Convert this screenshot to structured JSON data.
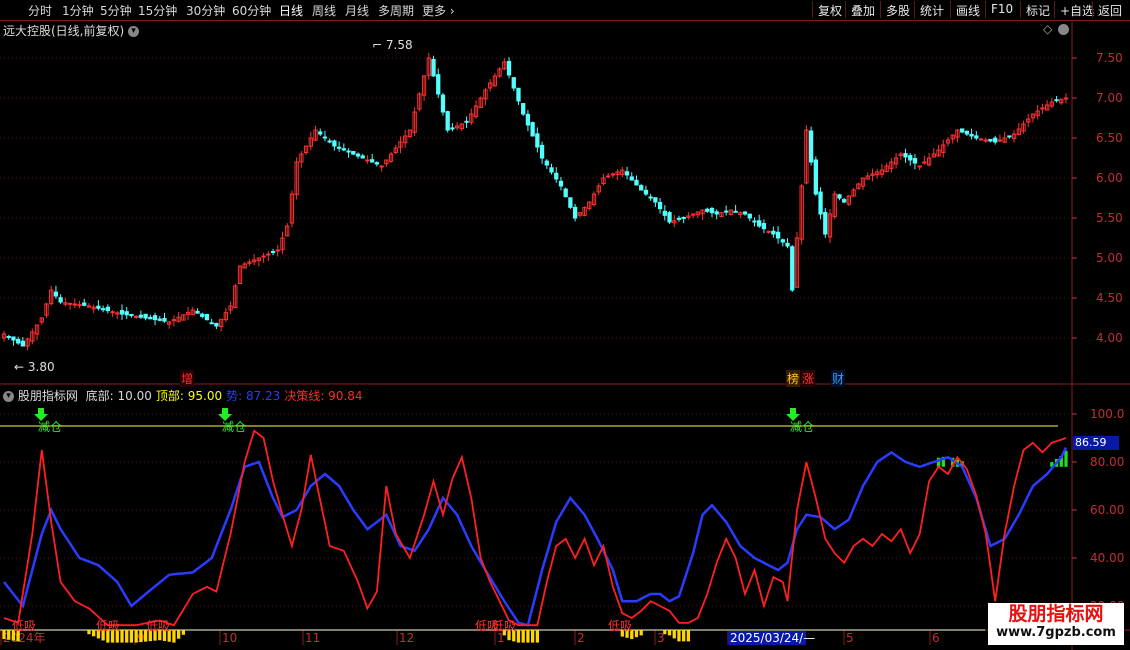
{
  "toolbar": {
    "periods": [
      "分时",
      "1分钟",
      "5分钟",
      "15分钟",
      "30分钟",
      "60分钟",
      "日线",
      "周线",
      "月线",
      "多周期",
      "更多"
    ],
    "active_period": "日线",
    "right_buttons": [
      "复权",
      "叠加",
      "多股",
      "统计",
      "画线",
      "F10",
      "标记",
      "+自选",
      "返回"
    ]
  },
  "main_chart": {
    "title": "远大控股(日线,前复权)",
    "high_label": "7.58",
    "low_label": "3.80",
    "event_tags": [
      "增",
      "榜",
      "涨",
      "财"
    ],
    "y_axis": {
      "min": 3.6,
      "max": 7.75,
      "ticks": [
        4.0,
        4.5,
        5.0,
        5.5,
        6.0,
        6.5,
        7.0,
        7.5
      ]
    }
  },
  "indicator": {
    "name": "股朋指标网",
    "params": [
      {
        "label": "底部:",
        "value": "10.00",
        "color": "#d8d8d8"
      },
      {
        "label": "顶部:",
        "value": "95.00",
        "color": "#ffff00"
      },
      {
        "label": "势:",
        "value": "87.23",
        "color": "#2a3cff"
      },
      {
        "label": "决策线:",
        "value": "90.84",
        "color": "#ff2a2a"
      }
    ],
    "y_axis": {
      "min": 10,
      "max": 105,
      "ticks": [
        20.0,
        40.0,
        60.0,
        80.0,
        100.0
      ]
    },
    "current_value": "86.59",
    "reduce_label": "减仓",
    "low_buy_label": "低吸",
    "bottom_line": 10,
    "top_line": 95
  },
  "x_axis": {
    "labels": [
      "2024年",
      "9",
      "10",
      "11",
      "12",
      "1",
      "2",
      "3",
      "2025/03/24/—",
      "5",
      "6"
    ]
  },
  "watermark": {
    "name": "股朋指标网",
    "url": "www.7gpzb.com"
  },
  "colors": {
    "up": "#ff3232",
    "down": "#54ffff",
    "grid": "#8a1a1a",
    "axis_text": "#c03030"
  },
  "chart_data": {
    "type": "line",
    "close_waypoints": [
      [
        0,
        4.05
      ],
      [
        4,
        3.9
      ],
      [
        8,
        4.25
      ],
      [
        10,
        4.6
      ],
      [
        12,
        4.45
      ],
      [
        18,
        4.4
      ],
      [
        25,
        4.3
      ],
      [
        35,
        4.2
      ],
      [
        40,
        4.35
      ],
      [
        45,
        4.15
      ],
      [
        48,
        4.4
      ],
      [
        50,
        4.9
      ],
      [
        54,
        5.0
      ],
      [
        58,
        5.1
      ],
      [
        60,
        5.4
      ],
      [
        62,
        6.2
      ],
      [
        66,
        6.6
      ],
      [
        70,
        6.4
      ],
      [
        74,
        6.3
      ],
      [
        80,
        6.15
      ],
      [
        86,
        6.6
      ],
      [
        90,
        7.5
      ],
      [
        94,
        6.6
      ],
      [
        98,
        6.7
      ],
      [
        102,
        7.1
      ],
      [
        106,
        7.45
      ],
      [
        110,
        6.8
      ],
      [
        114,
        6.25
      ],
      [
        118,
        5.9
      ],
      [
        121,
        5.5
      ],
      [
        124,
        5.7
      ],
      [
        127,
        6.0
      ],
      [
        131,
        6.1
      ],
      [
        135,
        5.85
      ],
      [
        138,
        5.7
      ],
      [
        141,
        5.45
      ],
      [
        144,
        5.5
      ],
      [
        148,
        5.6
      ],
      [
        151,
        5.55
      ],
      [
        154,
        5.6
      ],
      [
        157,
        5.55
      ],
      [
        160,
        5.4
      ],
      [
        163,
        5.3
      ],
      [
        166,
        5.15
      ],
      [
        167,
        4.6
      ],
      [
        169,
        5.9
      ],
      [
        170,
        6.6
      ],
      [
        172,
        5.8
      ],
      [
        174,
        5.3
      ],
      [
        176,
        5.8
      ],
      [
        178,
        5.7
      ],
      [
        182,
        6.0
      ],
      [
        186,
        6.1
      ],
      [
        190,
        6.3
      ],
      [
        194,
        6.15
      ],
      [
        198,
        6.35
      ],
      [
        202,
        6.6
      ],
      [
        206,
        6.5
      ],
      [
        210,
        6.45
      ],
      [
        214,
        6.55
      ],
      [
        218,
        6.8
      ],
      [
        222,
        6.95
      ],
      [
        225,
        7.0
      ]
    ],
    "decision_waypoints": [
      [
        0,
        15
      ],
      [
        3,
        13
      ],
      [
        6,
        50
      ],
      [
        8,
        85
      ],
      [
        10,
        55
      ],
      [
        12,
        30
      ],
      [
        15,
        22
      ],
      [
        18,
        19
      ],
      [
        22,
        12
      ],
      [
        28,
        12
      ],
      [
        33,
        14
      ],
      [
        36,
        12
      ],
      [
        40,
        25
      ],
      [
        43,
        28
      ],
      [
        45,
        26
      ],
      [
        48,
        50
      ],
      [
        51,
        80
      ],
      [
        53,
        93
      ],
      [
        55,
        90
      ],
      [
        57,
        72
      ],
      [
        59,
        58
      ],
      [
        61,
        45
      ],
      [
        63,
        60
      ],
      [
        65,
        83
      ],
      [
        67,
        64
      ],
      [
        69,
        45
      ],
      [
        72,
        43
      ],
      [
        75,
        30
      ],
      [
        77,
        19
      ],
      [
        79,
        26
      ],
      [
        81,
        70
      ],
      [
        83,
        50
      ],
      [
        86,
        40
      ],
      [
        89,
        58
      ],
      [
        91,
        72
      ],
      [
        93,
        58
      ],
      [
        95,
        73
      ],
      [
        97,
        82
      ],
      [
        99,
        65
      ],
      [
        101,
        40
      ],
      [
        103,
        30
      ],
      [
        105,
        22
      ],
      [
        107,
        14
      ],
      [
        109,
        12
      ],
      [
        111,
        12
      ],
      [
        113,
        12
      ],
      [
        115,
        30
      ],
      [
        117,
        45
      ],
      [
        119,
        48
      ],
      [
        121,
        40
      ],
      [
        123,
        48
      ],
      [
        125,
        37
      ],
      [
        127,
        45
      ],
      [
        129,
        28
      ],
      [
        131,
        17
      ],
      [
        133,
        15
      ],
      [
        135,
        18
      ],
      [
        137,
        22
      ],
      [
        139,
        20
      ],
      [
        141,
        18
      ],
      [
        143,
        13
      ],
      [
        145,
        13
      ],
      [
        147,
        15
      ],
      [
        149,
        25
      ],
      [
        151,
        38
      ],
      [
        153,
        48
      ],
      [
        155,
        40
      ],
      [
        157,
        25
      ],
      [
        159,
        35
      ],
      [
        161,
        20
      ],
      [
        163,
        32
      ],
      [
        165,
        30
      ],
      [
        166,
        22
      ],
      [
        168,
        60
      ],
      [
        170,
        80
      ],
      [
        172,
        65
      ],
      [
        174,
        48
      ],
      [
        176,
        42
      ],
      [
        178,
        38
      ],
      [
        180,
        45
      ],
      [
        182,
        48
      ],
      [
        184,
        45
      ],
      [
        186,
        50
      ],
      [
        188,
        47
      ],
      [
        190,
        52
      ],
      [
        192,
        42
      ],
      [
        194,
        50
      ],
      [
        196,
        72
      ],
      [
        198,
        78
      ],
      [
        200,
        75
      ],
      [
        202,
        82
      ],
      [
        204,
        77
      ],
      [
        206,
        66
      ],
      [
        208,
        50
      ],
      [
        210,
        22
      ],
      [
        212,
        50
      ],
      [
        214,
        70
      ],
      [
        216,
        85
      ],
      [
        218,
        88
      ],
      [
        220,
        84
      ],
      [
        222,
        88
      ],
      [
        225,
        90
      ]
    ],
    "trend_waypoints": [
      [
        0,
        30
      ],
      [
        4,
        20
      ],
      [
        8,
        50
      ],
      [
        10,
        60
      ],
      [
        12,
        52
      ],
      [
        16,
        40
      ],
      [
        20,
        37
      ],
      [
        24,
        30
      ],
      [
        27,
        20
      ],
      [
        30,
        25
      ],
      [
        35,
        33
      ],
      [
        40,
        34
      ],
      [
        44,
        40
      ],
      [
        48,
        60
      ],
      [
        51,
        78
      ],
      [
        54,
        80
      ],
      [
        57,
        65
      ],
      [
        59,
        57
      ],
      [
        62,
        60
      ],
      [
        65,
        70
      ],
      [
        68,
        75
      ],
      [
        71,
        70
      ],
      [
        74,
        60
      ],
      [
        77,
        52
      ],
      [
        79,
        55
      ],
      [
        81,
        58
      ],
      [
        84,
        45
      ],
      [
        87,
        43
      ],
      [
        90,
        52
      ],
      [
        93,
        65
      ],
      [
        96,
        58
      ],
      [
        99,
        45
      ],
      [
        102,
        35
      ],
      [
        106,
        22
      ],
      [
        109,
        13
      ],
      [
        111,
        12
      ],
      [
        114,
        35
      ],
      [
        117,
        55
      ],
      [
        120,
        65
      ],
      [
        123,
        58
      ],
      [
        126,
        47
      ],
      [
        129,
        35
      ],
      [
        131,
        22
      ],
      [
        134,
        22
      ],
      [
        137,
        25
      ],
      [
        139,
        25
      ],
      [
        141,
        22
      ],
      [
        143,
        24
      ],
      [
        146,
        42
      ],
      [
        148,
        58
      ],
      [
        150,
        62
      ],
      [
        153,
        55
      ],
      [
        156,
        45
      ],
      [
        159,
        40
      ],
      [
        161,
        38
      ],
      [
        164,
        35
      ],
      [
        166,
        38
      ],
      [
        168,
        52
      ],
      [
        170,
        58
      ],
      [
        173,
        57
      ],
      [
        176,
        52
      ],
      [
        179,
        56
      ],
      [
        182,
        70
      ],
      [
        185,
        80
      ],
      [
        188,
        84
      ],
      [
        191,
        80
      ],
      [
        194,
        78
      ],
      [
        197,
        80
      ],
      [
        200,
        82
      ],
      [
        203,
        78
      ],
      [
        206,
        65
      ],
      [
        209,
        45
      ],
      [
        212,
        48
      ],
      [
        215,
        58
      ],
      [
        218,
        70
      ],
      [
        221,
        75
      ],
      [
        224,
        82
      ],
      [
        225,
        86
      ]
    ],
    "x_count": 226
  }
}
